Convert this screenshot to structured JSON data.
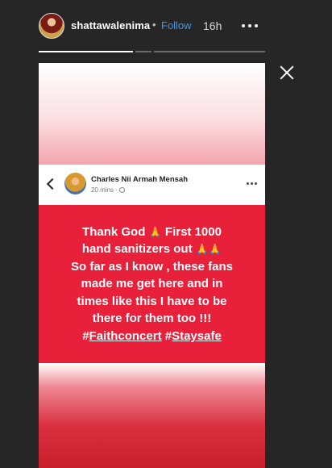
{
  "header": {
    "username": "shattawalenima",
    "separator": "•",
    "follow_label": "Follow",
    "time": "16h"
  },
  "progress": [
    {
      "fill": 1.0
    },
    {
      "fill": 0.0
    },
    {
      "fill": 0.0
    }
  ],
  "post": {
    "author": "Charles Nii Armah Mensah",
    "meta": "20 mins ·",
    "lines": [
      "Thank God",
      "First 1000",
      "hand sanitizers out",
      "So far as I know , these fans",
      "made me get here and in",
      "times like this I have to be",
      "there for them too !!!"
    ],
    "pray_emoji": "🙏",
    "pray_emoji_double": "🙏🙏",
    "hashtag_prefix": "#",
    "hashtags": [
      "Faithconcert",
      "Staysafe"
    ]
  },
  "colors": {
    "background": "#262626",
    "follow": "#3897f0",
    "post_red": "#e8203a"
  },
  "icons": [
    "more-options-icon",
    "close-icon",
    "back-chevron-icon",
    "globe-icon"
  ]
}
